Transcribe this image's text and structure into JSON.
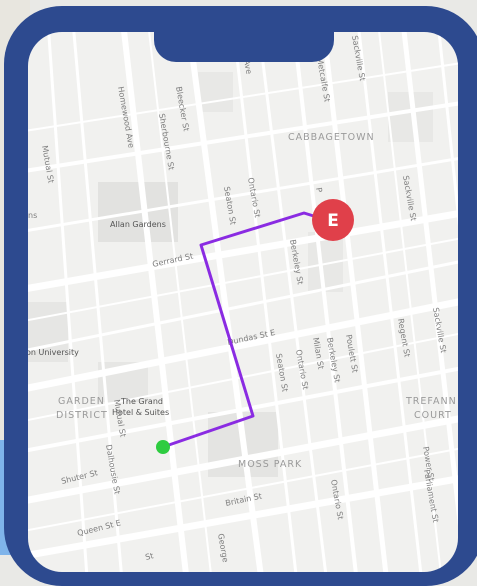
{
  "map": {
    "areas": {
      "cabbagetown": "CABBAGETOWN",
      "moss_park": "MOSS PARK",
      "garden": "GARDEN",
      "district": "DISTRICT",
      "trefann": "TREFANN",
      "court": "COURT"
    },
    "pois": {
      "allan_gardens": "Allan Gardens",
      "grand_hotel_1": "The Grand",
      "grand_hotel_2": "Hotel & Suites",
      "university": "on University"
    },
    "streets": {
      "homewood": "Homewood Ave",
      "bleecker": "Bleecker St",
      "sherbourne": "Sherbourne St",
      "mutual_top": "Mutual St",
      "ave_top": "Ave",
      "metcalfe": "Metcalfe St",
      "sackville_top": "Sackville St",
      "seaton_top": "Seaton St",
      "ontario_top": "Ontario St",
      "berkeley_top": "Berkeley St",
      "p_top": "P",
      "sackville_right": "Sackville St",
      "gerrard": "Gerrard St",
      "ns": "ns",
      "dundas": "Dundas St E",
      "sackville_mid": "Sackville St",
      "regent": "Regent St",
      "seaton_mid": "Seaton St",
      "ontario_mid": "Ontario St",
      "milan": "Milan St",
      "berkeley_mid": "Berkeley St",
      "poulett": "Poulett St",
      "mutual_mid": "Mutual St",
      "dalhousie": "Dalhousie St",
      "shuter": "Shuter St",
      "power": "Power St",
      "parliament": "Parliament St",
      "ontario_bot": "Ontario St",
      "britain": "Britain St",
      "queen": "Queen St E",
      "george": "George",
      "st_bot": "St"
    },
    "markers": {
      "end_label": "E",
      "end_color": "#e0404a",
      "start_color": "#2ecc40",
      "route_color": "#8a2be2"
    }
  }
}
